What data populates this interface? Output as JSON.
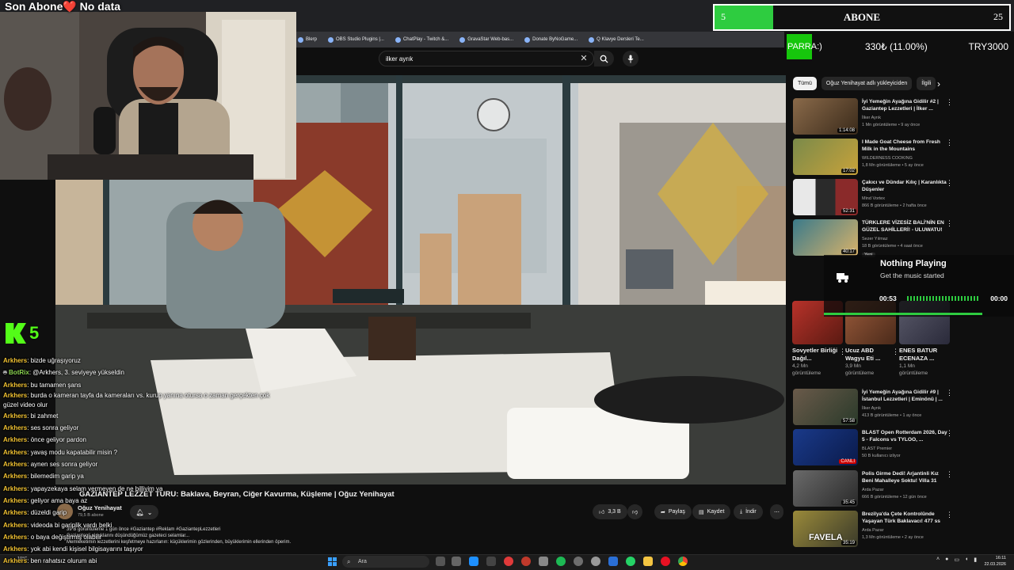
{
  "overlay": {
    "subscriber_line": "Son Abone❤️ No data",
    "abone": {
      "left": "5",
      "title": "ABONE",
      "right": "25",
      "progress": 0.2
    },
    "ticker": {
      "tag": "PARRA:)",
      "item1": "330₺ (11.00%)",
      "item2": "TRY3000",
      "accent": "#16c60c"
    },
    "kick": {
      "count": "5",
      "color": "#53fc18"
    },
    "now_playing": {
      "title": "Nothing Playing",
      "subtitle": "Get the music started",
      "elapsed": "00:53",
      "remaining": "00:00"
    }
  },
  "browser": {
    "bookmarks": [
      "Blerp",
      "OBS Studio Plugins |...",
      "ChatPlay - Twitch &...",
      "GravaStar Web-bas...",
      "Donate ByNoGame...",
      "Q Klavye Dersleri Te..."
    ],
    "search_value": "ilker ayrık"
  },
  "video": {
    "title": "GAZİANTEP LEZZET TURU: Baklava, Beyran, Ciğer Kavurma, Küşleme | Oğuz Yenihayat",
    "channel": "Oğuz Yenihayat",
    "subscribers": "79,5 B abone",
    "actions": {
      "likes": "3,3 B",
      "share": "Paylaş",
      "save": "Kaydet",
      "download": "İndir",
      "more": "⋯"
    },
    "description_meta": "39 B görüntüleme  1 gün önce  #Gaziantep #Reklam #GaziantepLezzetleri",
    "description_line2": "Gaziantepli olduklarını düşündüğümüz gazeteci selamlar...",
    "description_line3": "Memleketimin lezzetlerini keşfetmeye hazırlanın: küçüklerimin gözlerinden, büyüklerimin ellerinden öperim."
  },
  "sidebar": {
    "chips": [
      "Tümü",
      "Oğuz Yenihayat adlı yükleyiciden",
      "İlgili"
    ],
    "recs_top": [
      {
        "title": "İyi Yemeğin Ayağına Gidilir #2 | Gaziantep Lezzetleri | İlker ...",
        "channel": "İlker Ayrık",
        "meta": "1 Mn görüntüleme • 9 ay önce",
        "duration": "1:14:08",
        "thumb": "#7a5a3a"
      },
      {
        "title": "I Made Goat Cheese from Fresh Milk in the Mountains",
        "channel": "WILDERNESS COOKING",
        "meta": "1,8 Mn görüntüleme • 5 ay önce",
        "duration": "17:02",
        "thumb": "#6b7c3a"
      },
      {
        "title": "Çakıcı ve Dündar Kılıç | Karanlıkta Düşenler",
        "channel": "Mind Vortex",
        "meta": "866 B görüntüleme • 2 hafta önce",
        "duration": "52:31",
        "thumb": "#2a2a2a"
      },
      {
        "title": "TÜRKLERE VİZESİZ BALİ'NİN EN GÜZEL SAHİLLERİ! - ULUWATU!",
        "channel": "Sezer Yılmaz",
        "meta": "18 B görüntüleme • 4 saat önce",
        "duration": "40:17",
        "thumb": "#3a6a7a",
        "badge": "Yeni"
      }
    ],
    "shorts": [
      {
        "title": "Sovyetler Birliği Dağıl...",
        "meta1": "4,2 Mn",
        "meta2": "görüntüleme",
        "thumb": "#8a2a1a"
      },
      {
        "title": "Ucuz ABD Wagyu Eti ...",
        "meta1": "3,9 Mn",
        "meta2": "görüntüleme",
        "thumb": "#6a3a2a"
      },
      {
        "title": "ENES BATUR ECENAZA ...",
        "meta1": "1,1 Mn",
        "meta2": "görüntüleme",
        "thumb": "#3a3a4a"
      }
    ],
    "recs_bottom": [
      {
        "title": "İyi Yemeğin Ayağına Gidilir #9 | İstanbul Lezzetleri | Eminönü | ...",
        "channel": "İlker Ayrık",
        "meta": "413 B görüntüleme • 1 ay önce",
        "duration": "57:58",
        "thumb": "#5a4a3a"
      },
      {
        "title": "BLAST Open Rotterdam 2026, Day 5 - Falcons vs TYLOO, ...",
        "channel": "BLAST Premier",
        "meta": "50 B kullanıcı izliyor",
        "duration": "CANLI",
        "thumb": "#1a2a6a"
      },
      {
        "title": "Polis Girme Dedi! Arjantinli Kız Beni Mahalleye Soktu! Villa 31",
        "channel": "Arda Pazar",
        "meta": "666 B görüntüleme • 12 gün önce",
        "duration": "35:45",
        "thumb": "#5a5a5a"
      },
      {
        "title": "Brezilya'da Çete Kontrolünde Yaşayan Türk Baklavacı! 477 ss",
        "channel": "Arda Pazar",
        "meta": "1,3 Mn görüntüleme • 2 ay önce",
        "duration": "35:19",
        "thumb": "#7a6a2a",
        "overlay": "FAVELA"
      }
    ]
  },
  "chat": {
    "messages": [
      {
        "user": "Arkhers",
        "text": "bizde uğraşıyoruz"
      },
      {
        "user": "BotRix",
        "text": "@Arkhers, 3. seviyeye yükseldin",
        "bot": true
      },
      {
        "user": "Arkhers",
        "text": "bu tamamen şans"
      },
      {
        "user": "Arkhers",
        "text": "burda o kameran tayfa da kameraları vs. kurup yanına otursa o zaman gerçekten çok güzel video olur",
        "wrap": true
      },
      {
        "user": "Arkhers",
        "text": "bi zahmet"
      },
      {
        "user": "Arkhers",
        "text": "ses sonra geliyor"
      },
      {
        "user": "Arkhers",
        "text": "önce geliyor pardon"
      },
      {
        "user": "Arkhers",
        "text": "yavaş modu kapatabilir misin ?"
      },
      {
        "user": "Arkhers",
        "text": "aynen ses sonra geliyor"
      },
      {
        "user": "Arkhers",
        "text": "bilemedim garip ya"
      },
      {
        "user": "Arkhers",
        "text": "yapayzekaya selam vermeyen de ne billiyim ya"
      },
      {
        "user": "Arkhers",
        "text": "geliyor ama baya az"
      },
      {
        "user": "Arkhers",
        "text": "düzeldi garip"
      },
      {
        "user": "Arkhers",
        "text": "videoda bi gariplik vardı belki"
      },
      {
        "user": "Arkhers",
        "text": "o baya değiştirmiş olabilir"
      },
      {
        "user": "Arkhers",
        "text": "yok abi kendi kişisel bilgisayarını taşıyor"
      },
      {
        "user": "Arkhers",
        "text": "ben rahatsız olurum abi"
      }
    ]
  },
  "taskbar": {
    "weather": "10°C",
    "search": "Ara",
    "time": "16:11",
    "date": "22.03.2026"
  }
}
